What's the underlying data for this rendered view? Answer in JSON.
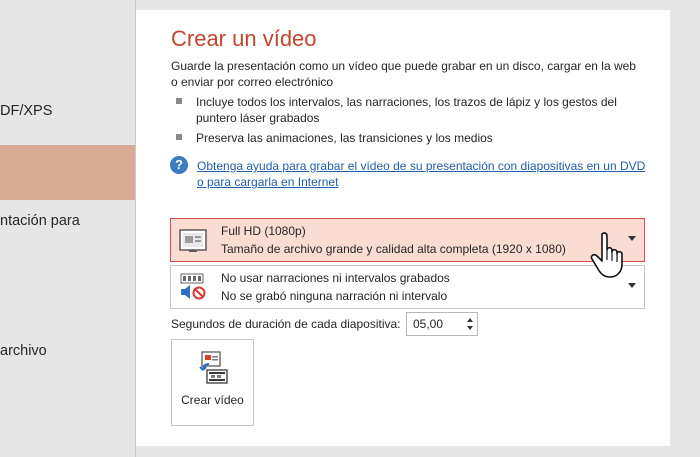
{
  "nav": {
    "items": [
      {
        "label": "DF/XPS"
      },
      {
        "label": ""
      },
      {
        "label": "ntación para"
      },
      {
        "label": "archivo"
      }
    ]
  },
  "panel": {
    "title": "Crear un vídeo",
    "description": "Guarde la presentación como un vídeo que puede grabar en un disco, cargar en la web o enviar por correo electrónico",
    "bullets": [
      "Incluye todos los intervalos, las narraciones, los trazos de lápiz y los gestos del puntero láser grabados",
      "Preserva las animaciones, las transiciones y los medios"
    ],
    "help_link": "Obtenga ayuda para grabar el vídeo de su presentación con diapositivas en un DVD o para cargarla en Internet"
  },
  "quality_dropdown": {
    "title": "Full HD (1080p)",
    "subtitle": "Tamaño de archivo grande y calidad alta completa (1920 x 1080)"
  },
  "timing_dropdown": {
    "title": "No usar narraciones ni intervalos grabados",
    "subtitle": "No se grabó ninguna narración ni intervalo"
  },
  "seconds": {
    "label": "Segundos de duración de cada diapositiva:",
    "value": "05,00"
  },
  "create_button": {
    "label": "Crear vídeo"
  },
  "colors": {
    "accent": "#c4452b",
    "selected_nav": "#d9ab97",
    "highlight_bg": "#fbdcd3",
    "highlight_border": "#e24a4a",
    "link": "#1f5ea8"
  },
  "icons": {
    "help": "help-question-icon",
    "quality": "monitor-slide-icon",
    "timing": "speaker-mute-icon",
    "create": "video-export-icon",
    "cursor": "hand-pointer-icon"
  }
}
